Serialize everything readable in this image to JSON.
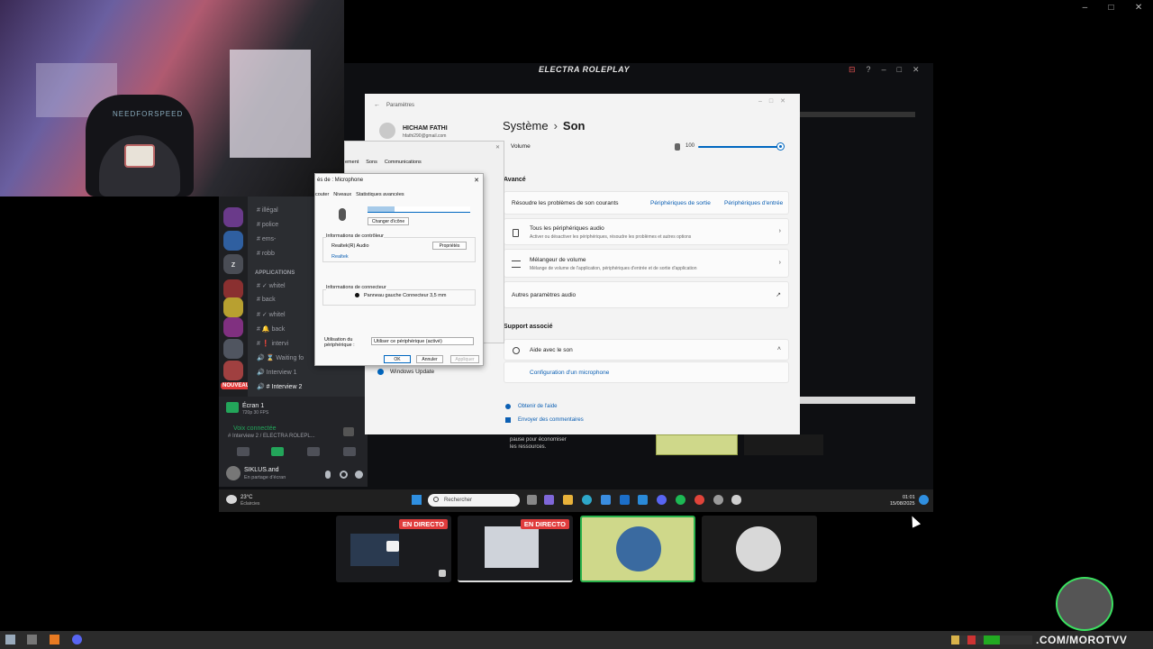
{
  "outer_window": {
    "controls": [
      "–",
      "□",
      "✕"
    ]
  },
  "webcam": {
    "chair_brand": "NEEDFORSPEED"
  },
  "stream": {
    "title": "ELECTRA ROLEPLAY",
    "controls": [
      "⊟",
      "?",
      "–",
      "□",
      "✕"
    ]
  },
  "discord": {
    "servers": [
      "z"
    ],
    "nouveau_badge": "NOUVEAU",
    "category": "APPLICATIONS",
    "channels": [
      {
        "label": "# illégal",
        "active": false
      },
      {
        "label": "# police",
        "active": false
      },
      {
        "label": "# ems-",
        "active": false
      },
      {
        "label": "# robb",
        "active": false
      },
      {
        "label": "# ✓ whitel",
        "active": false
      },
      {
        "label": "# back",
        "active": false
      },
      {
        "label": "# ✓ whitel",
        "active": false
      },
      {
        "label": "# 🔔 back",
        "active": false
      },
      {
        "label": "# ❗ intervi",
        "active": false
      },
      {
        "label": "🔊 ⌛ Waiting fo",
        "active": false
      },
      {
        "label": "🔊 Interview 1",
        "active": false
      },
      {
        "label": "🔊 # Interview 2",
        "active": true
      }
    ],
    "stream_label": "Écran 1",
    "stream_sub": "720p 30 FPS",
    "voice_status": "Voix connectée",
    "voice_channel": "# Interview 2 / ELECTRA ROLEPL...",
    "user_name": "SIKLUS.and",
    "user_status": "En partage d'écran"
  },
  "settings": {
    "window_title": "Paramètres",
    "user_name": "HICHAM FATHI",
    "user_email": "hfathi290@gmail.com",
    "breadcrumb_parent": "Système",
    "breadcrumb_current": "Son",
    "volume_label": "Volume",
    "volume_value": "100",
    "advanced_header": "Avancé",
    "troubleshoot_label": "Résoudre les problèmes de son courants",
    "output_devices_link": "Périphériques de sortie",
    "input_devices_link": "Périphériques d'entrée",
    "all_devices_title": "Tous les périphériques audio",
    "all_devices_sub": "Activer ou désactiver les périphériques, résoudre les problèmes et autres options",
    "mixer_title": "Mélangeur de volume",
    "mixer_sub": "Mélange de volume de l'application, périphériques d'entrée et de sortie d'application",
    "more_params": "Autres paramètres audio",
    "support_header": "Support associé",
    "help_sound": "Aide avec le son",
    "mic_config": "Configuration d'un microphone",
    "windows_update": "Windows Update",
    "get_help": "Obtenir de l'aide",
    "send_feedback": "Envoyer des commentaires"
  },
  "sons_dialog": {
    "tabs": [
      "ement",
      "Sons",
      "Communications"
    ]
  },
  "mic_dialog": {
    "title": "és de : Microphone",
    "tabs": [
      "couter",
      "Niveaux",
      "Statistiques avancées"
    ],
    "name_value": "Microphone",
    "change_icon": "Changer d'icône",
    "controller_header": "Informations de contrôleur",
    "controller_name": "Realtek(R) Audio",
    "properties_btn": "Propriétés",
    "vendor": "Realtek",
    "connector_header": "Informations de connecteur",
    "connector_value": "Panneau gauche Connecteur 3,5 mm",
    "usage_label": "Utilisation du périphérique :",
    "usage_value": "Utiliser ce périphérique (activé)",
    "ok": "OK",
    "cancel": "Annuler",
    "apply": "Appliquer"
  },
  "pause_text": "pause pour économiser les ressources.",
  "inner_taskbar": {
    "weather_temp": "23°C",
    "weather_desc": "Éclaircies",
    "search_placeholder": "Rechercher",
    "time": "01:01",
    "date": "15/08/2025"
  },
  "tiles": {
    "live_label_1": "EN DIRECTO",
    "live_label_2": "EN DIRECTO"
  },
  "watermark": ".COM/MOROTVV",
  "colors": {
    "accent": "#0067c0",
    "live_red": "#e03c3c",
    "discord_bg": "#2b2d31",
    "tile_highlight": "#cfd88a"
  }
}
